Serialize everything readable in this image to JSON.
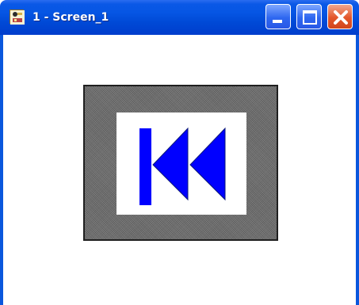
{
  "window": {
    "title": "1 - Screen_1"
  },
  "icons": {
    "app": "app-icon",
    "minimize": "minimize-icon",
    "maximize": "maximize-icon",
    "close": "close-icon",
    "control": "skip-back-icon"
  },
  "colors": {
    "titlebar": "#0656e4",
    "frame": "#6b6b6b",
    "control_symbol": "#0000ff",
    "close_button": "#e3562a"
  }
}
